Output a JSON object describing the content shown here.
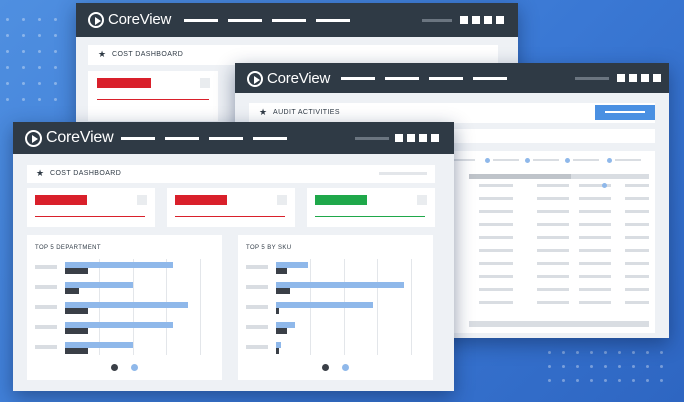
{
  "brand": {
    "logo_text": "CoreView"
  },
  "windows": {
    "back_cost": {
      "panel_title": "COST DASHBOARD"
    },
    "audit": {
      "panel_title": "AUDIT ACTIVITIES"
    },
    "front_cost": {
      "panel_title": "COST DASHBOARD",
      "kpis": [
        {
          "color": "#d9202b"
        },
        {
          "color": "#d9202b"
        },
        {
          "color": "#1fa84a"
        }
      ],
      "charts": [
        {
          "title": "TOP 5 DEPARTMENT",
          "bars": [
            {
              "blue": 0.8,
              "dark": 0.17
            },
            {
              "blue": 0.5,
              "dark": 0.1
            },
            {
              "blue": 0.91,
              "dark": 0.17
            },
            {
              "blue": 0.8,
              "dark": 0.17
            },
            {
              "blue": 0.5,
              "dark": 0.17
            }
          ]
        },
        {
          "title": "TOP 5 BY SKU",
          "bars": [
            {
              "blue": 0.24,
              "dark": 0.08
            },
            {
              "blue": 0.95,
              "dark": 0.1
            },
            {
              "blue": 0.72,
              "dark": 0.02
            },
            {
              "blue": 0.14,
              "dark": 0.08
            },
            {
              "blue": 0.04,
              "dark": 0.02
            }
          ]
        }
      ]
    }
  },
  "colors": {
    "accent": "#4a90e2",
    "titlebar": "#2f3a45",
    "bar_blue": "#8fb8ea",
    "bar_dark": "#3a3f47"
  }
}
